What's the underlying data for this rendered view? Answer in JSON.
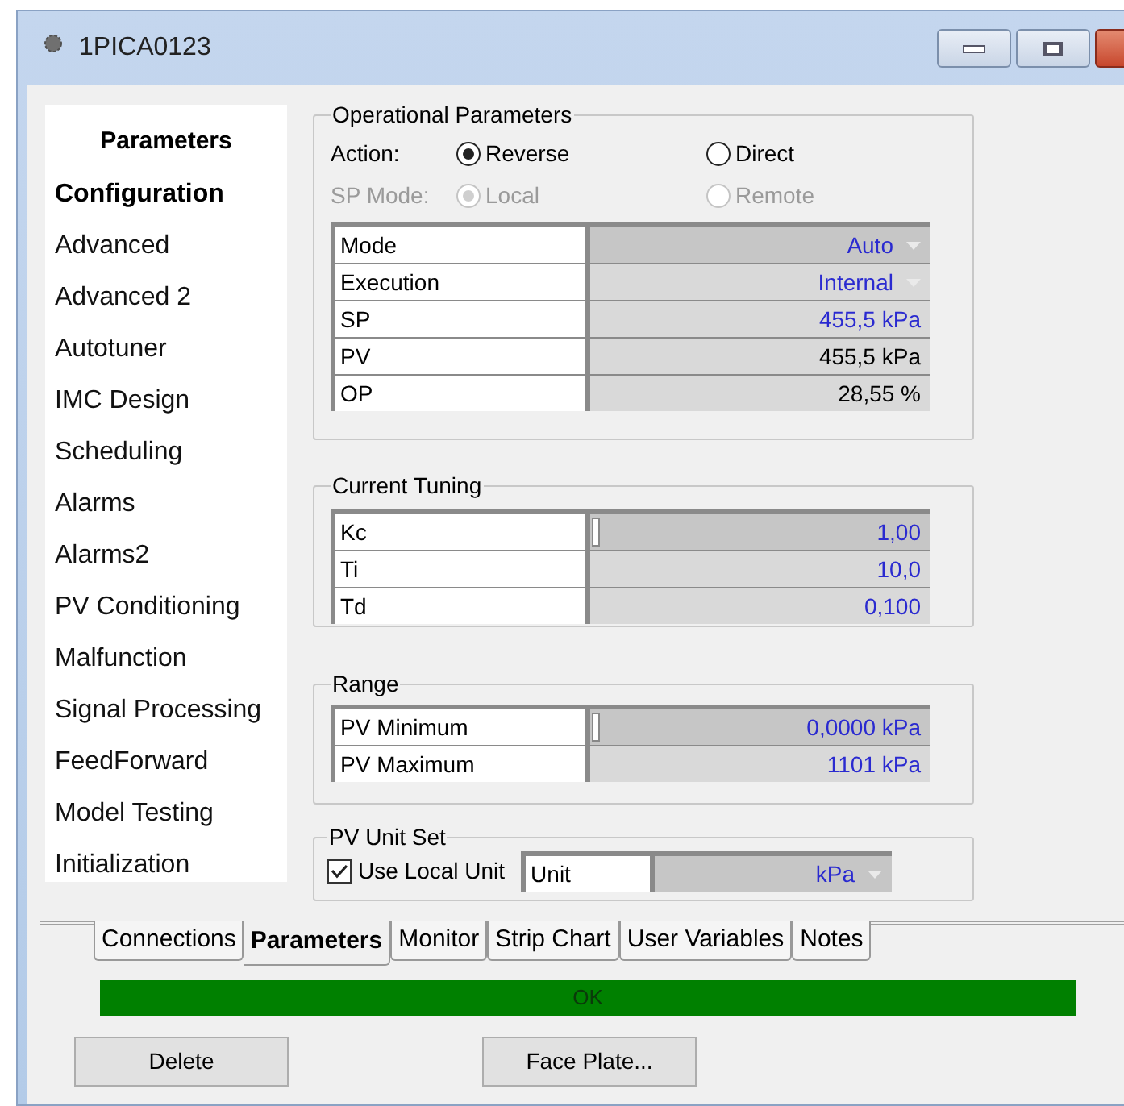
{
  "window": {
    "title": "1PICA0123"
  },
  "sidebar": {
    "header": "Parameters",
    "items": [
      {
        "label": "Configuration",
        "selected": true
      },
      {
        "label": "Advanced",
        "selected": false
      },
      {
        "label": "Advanced 2",
        "selected": false
      },
      {
        "label": "Autotuner",
        "selected": false
      },
      {
        "label": "IMC Design",
        "selected": false
      },
      {
        "label": "Scheduling",
        "selected": false
      },
      {
        "label": "Alarms",
        "selected": false
      },
      {
        "label": "Alarms2",
        "selected": false
      },
      {
        "label": "PV Conditioning",
        "selected": false
      },
      {
        "label": "Malfunction",
        "selected": false
      },
      {
        "label": "Signal Processing",
        "selected": false
      },
      {
        "label": "FeedForward",
        "selected": false
      },
      {
        "label": "Model Testing",
        "selected": false
      },
      {
        "label": "Initialization",
        "selected": false
      }
    ]
  },
  "operational_parameters": {
    "title": "Operational Parameters",
    "radio_rows": [
      {
        "label": "Action:",
        "disabled": false,
        "options": [
          {
            "label": "Reverse",
            "selected": true
          },
          {
            "label": "Direct",
            "selected": false
          }
        ]
      },
      {
        "label": "SP Mode:",
        "disabled": true,
        "options": [
          {
            "label": "Local",
            "selected": true
          },
          {
            "label": "Remote",
            "selected": false
          }
        ]
      }
    ],
    "rows": [
      {
        "name": "Mode",
        "value": "Auto",
        "selected": true,
        "editable": true,
        "dropdown": true,
        "cursor": false
      },
      {
        "name": "Execution",
        "value": "Internal",
        "selected": false,
        "editable": true,
        "dropdown": true,
        "cursor": false
      },
      {
        "name": "SP",
        "value": "455,5 kPa",
        "selected": false,
        "editable": true,
        "dropdown": false,
        "cursor": false
      },
      {
        "name": "PV",
        "value": "455,5 kPa",
        "selected": false,
        "editable": false,
        "dropdown": false,
        "cursor": false
      },
      {
        "name": "OP",
        "value": "28,55 %",
        "selected": false,
        "editable": false,
        "dropdown": false,
        "cursor": false
      }
    ]
  },
  "current_tuning": {
    "title": "Current Tuning",
    "rows": [
      {
        "name": "Kc",
        "value": "1,00",
        "selected": true,
        "editable": true,
        "dropdown": false,
        "cursor": true
      },
      {
        "name": "Ti",
        "value": "10,0",
        "selected": false,
        "editable": true,
        "dropdown": false,
        "cursor": false
      },
      {
        "name": "Td",
        "value": "0,100",
        "selected": false,
        "editable": true,
        "dropdown": false,
        "cursor": false
      }
    ]
  },
  "range": {
    "title": "Range",
    "rows": [
      {
        "name": "PV Minimum",
        "value": "0,0000 kPa",
        "selected": true,
        "editable": true,
        "dropdown": false,
        "cursor": true
      },
      {
        "name": "PV Maximum",
        "value": "1101 kPa",
        "selected": false,
        "editable": true,
        "dropdown": false,
        "cursor": false
      }
    ]
  },
  "pv_unit_set": {
    "title": "PV Unit Set",
    "checkbox": {
      "label": "Use Local Unit",
      "checked": true
    },
    "unit": {
      "name": "Unit",
      "value": "kPa",
      "selected": true,
      "editable": true,
      "dropdown": true,
      "cursor": false
    }
  },
  "tabs": [
    {
      "label": "Connections",
      "selected": false
    },
    {
      "label": "Parameters",
      "selected": true
    },
    {
      "label": "Monitor",
      "selected": false
    },
    {
      "label": "Strip Chart",
      "selected": false
    },
    {
      "label": "User Variables",
      "selected": false
    },
    {
      "label": "Notes",
      "selected": false
    }
  ],
  "status": {
    "text": "OK",
    "color": "#008000"
  },
  "buttons": [
    "Delete",
    "Face Plate..."
  ]
}
